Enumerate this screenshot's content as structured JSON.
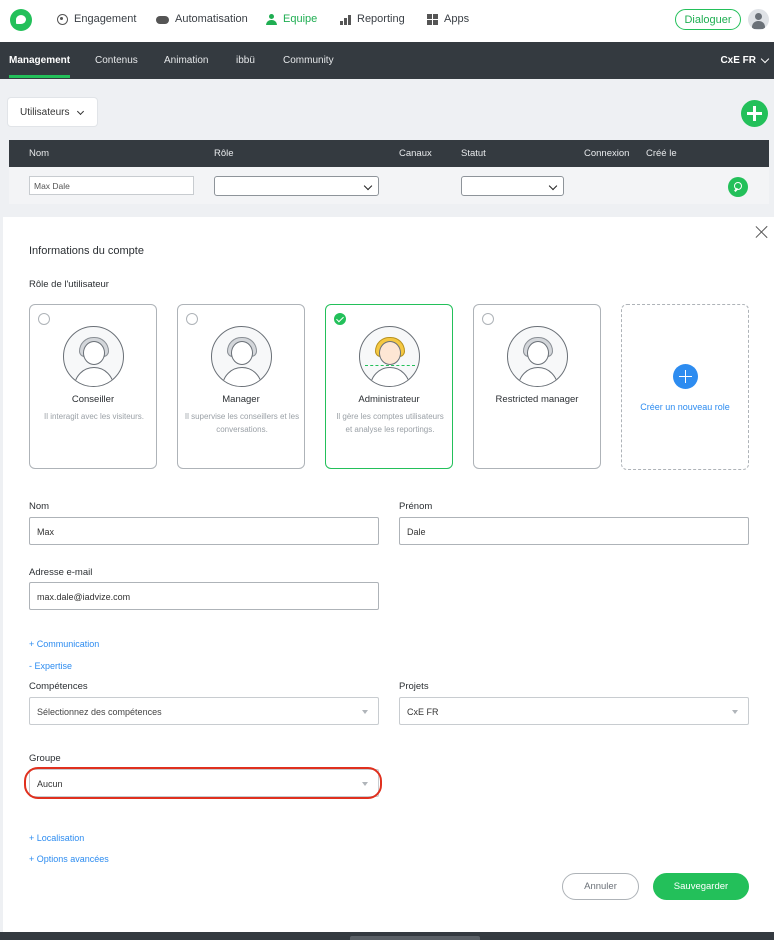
{
  "topnav": {
    "items": [
      {
        "label": "Engagement",
        "icon": "target-icon"
      },
      {
        "label": "Automatisation",
        "icon": "cloud-icon"
      },
      {
        "label": "Equipe",
        "icon": "user-icon",
        "active": true
      },
      {
        "label": "Reporting",
        "icon": "bar-chart-icon"
      },
      {
        "label": "Apps",
        "icon": "grid-icon"
      }
    ],
    "dialog_button": "Dialoguer"
  },
  "subnav": {
    "items": [
      "Management",
      "Contenus",
      "Animation",
      "ibbü",
      "Community"
    ],
    "active": "Management",
    "project": "CxE FR"
  },
  "filters": {
    "view_dropdown": "Utilisateurs",
    "columns": [
      "Nom",
      "Rôle",
      "Canaux",
      "Statut",
      "Connexion",
      "Créé le"
    ],
    "name_filter_value": "Max Dale"
  },
  "panel": {
    "title": "Informations du compte",
    "role_section_label": "Rôle de l'utilisateur",
    "roles": [
      {
        "name": "Conseiller",
        "description": "Il interagit avec les visiteurs.",
        "selected": false
      },
      {
        "name": "Manager",
        "description": "Il supervise les conseillers et les conversations.",
        "selected": false
      },
      {
        "name": "Administrateur",
        "description": "Il gère les comptes utilisateurs et analyse les reportings.",
        "selected": true
      },
      {
        "name": "Restricted manager",
        "description": "",
        "selected": false
      }
    ],
    "new_role_label": "Créer un nouveau role",
    "fields": {
      "nom_label": "Nom",
      "nom_value": "Max",
      "prenom_label": "Prénom",
      "prenom_value": "Dale",
      "email_label": "Adresse e-mail",
      "email_value": "max.dale@iadvize.com"
    },
    "links": {
      "communication": "+ Communication",
      "expertise": "- Expertise",
      "localisation": "+ Localisation",
      "options": "+ Options avancées"
    },
    "competences_label": "Compétences",
    "competences_placeholder": "Sélectionnez des compétences",
    "projets_label": "Projets",
    "projets_value": "CxE FR",
    "groupe_label": "Groupe",
    "groupe_value": "Aucun",
    "cancel_button": "Annuler",
    "save_button": "Sauvegarder"
  },
  "colors": {
    "accent": "#23c05a",
    "dark": "#343a40",
    "link": "#2d8cf0",
    "highlight": "#e0301e"
  }
}
